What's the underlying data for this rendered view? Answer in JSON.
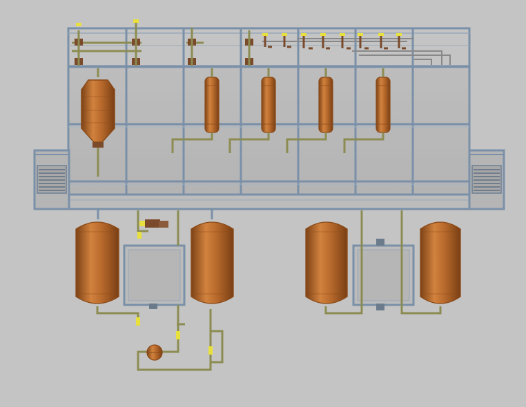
{
  "scene": {
    "title": "",
    "colors": {
      "background": "#c4c4c4",
      "frame": "#7a90a8",
      "frame_dark": "#5d6f82",
      "panel": "#b9b9b9",
      "vessel": "#b86a2c",
      "vessel_highlight": "#d68a45",
      "vessel_shadow": "#8a4a18",
      "pipe": "#8c8c52",
      "pipe_dark": "#6b6b3a",
      "valve_yellow": "#e8e03c",
      "dark_fitting": "#7a4a2a"
    },
    "components": {
      "platform": "upper-process-platform",
      "side_stairs": [
        "left-stair",
        "right-stair"
      ],
      "conical_reactor_count": 1,
      "column_count": 4,
      "bottom_tank_count": 4,
      "cabinet_count": 2,
      "pump_count": 1
    },
    "labels": []
  }
}
